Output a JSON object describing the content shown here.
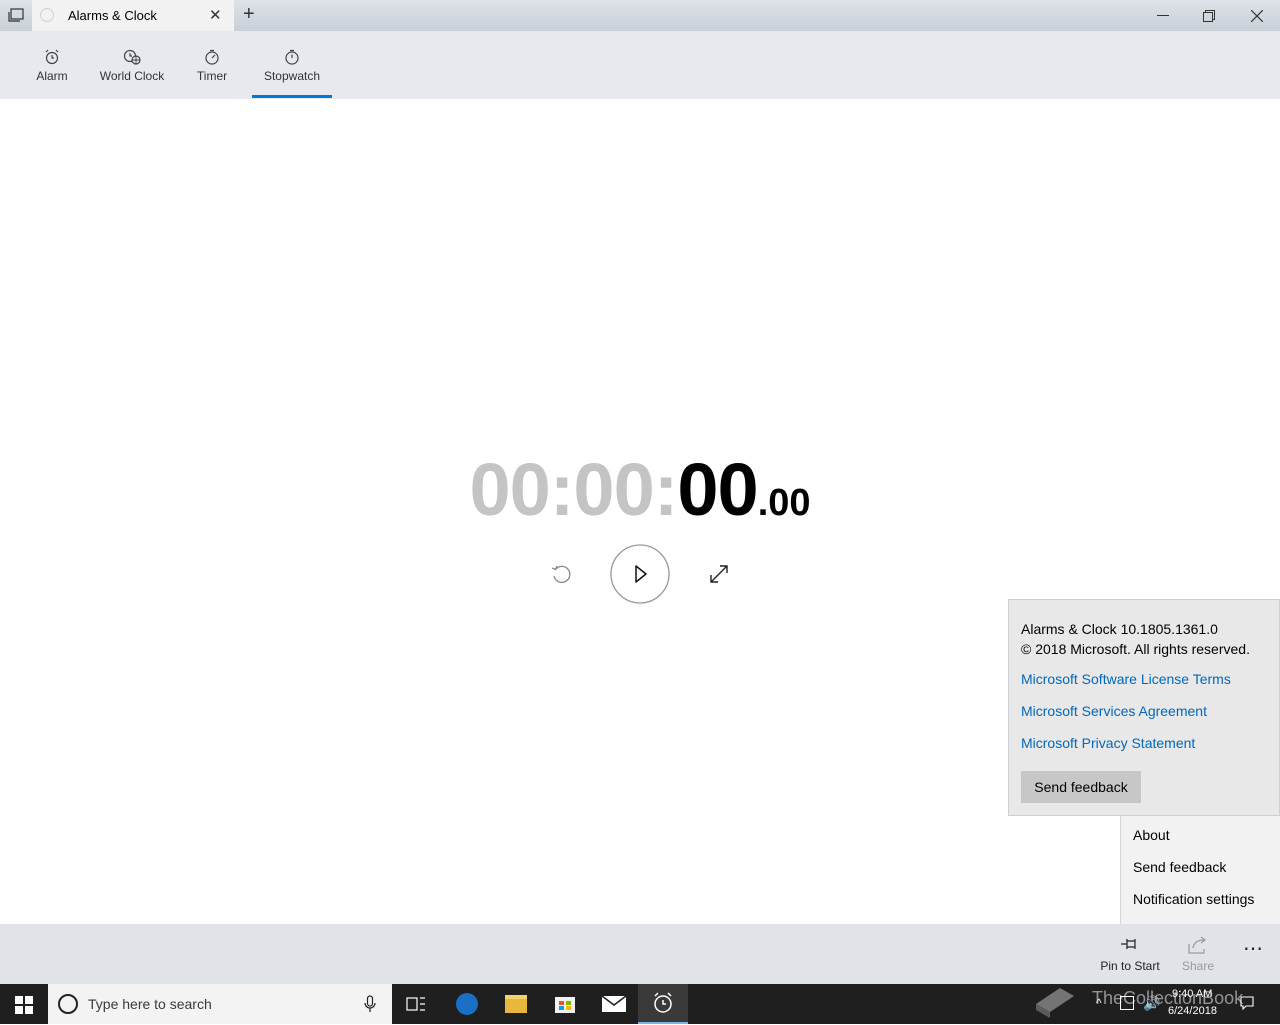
{
  "window": {
    "tab_title": "Alarms & Clock",
    "new_tab": "+",
    "close_tab": "✕",
    "minimize": "—",
    "maximize": "❐",
    "close": "✕"
  },
  "nav": {
    "items": [
      {
        "label": "Alarm",
        "icon": "alarm-clock-icon"
      },
      {
        "label": "World Clock",
        "icon": "world-clock-icon"
      },
      {
        "label": "Timer",
        "icon": "timer-icon"
      },
      {
        "label": "Stopwatch",
        "icon": "stopwatch-icon"
      }
    ],
    "selected": "Stopwatch",
    "accent": "#0078d7"
  },
  "stopwatch": {
    "hours": "00",
    "sep1": ":",
    "minutes": "00",
    "sep2": ":",
    "seconds": "00",
    "hundredths": ".00"
  },
  "controls": {
    "reset_icon": "reset-icon",
    "play_icon": "play-icon",
    "expand_icon": "expand-icon"
  },
  "about": {
    "version": "Alarms & Clock 10.1805.1361.0",
    "copyright": "© 2018 Microsoft. All rights reserved.",
    "links": [
      "Microsoft Software License Terms",
      "Microsoft Services Agreement",
      "Microsoft Privacy Statement"
    ],
    "feedback_button": "Send feedback",
    "link_color": "#0067c0"
  },
  "more_menu": {
    "items": [
      "About",
      "Send feedback",
      "Notification settings"
    ]
  },
  "command_bar": {
    "pin_label": "Pin to Start",
    "share_label": "Share",
    "more": "⋯"
  },
  "taskbar": {
    "search_placeholder": "Type here to search",
    "time": "9:40 AM",
    "date": "6/24/2018",
    "watermark": "TheCollectionBook"
  }
}
